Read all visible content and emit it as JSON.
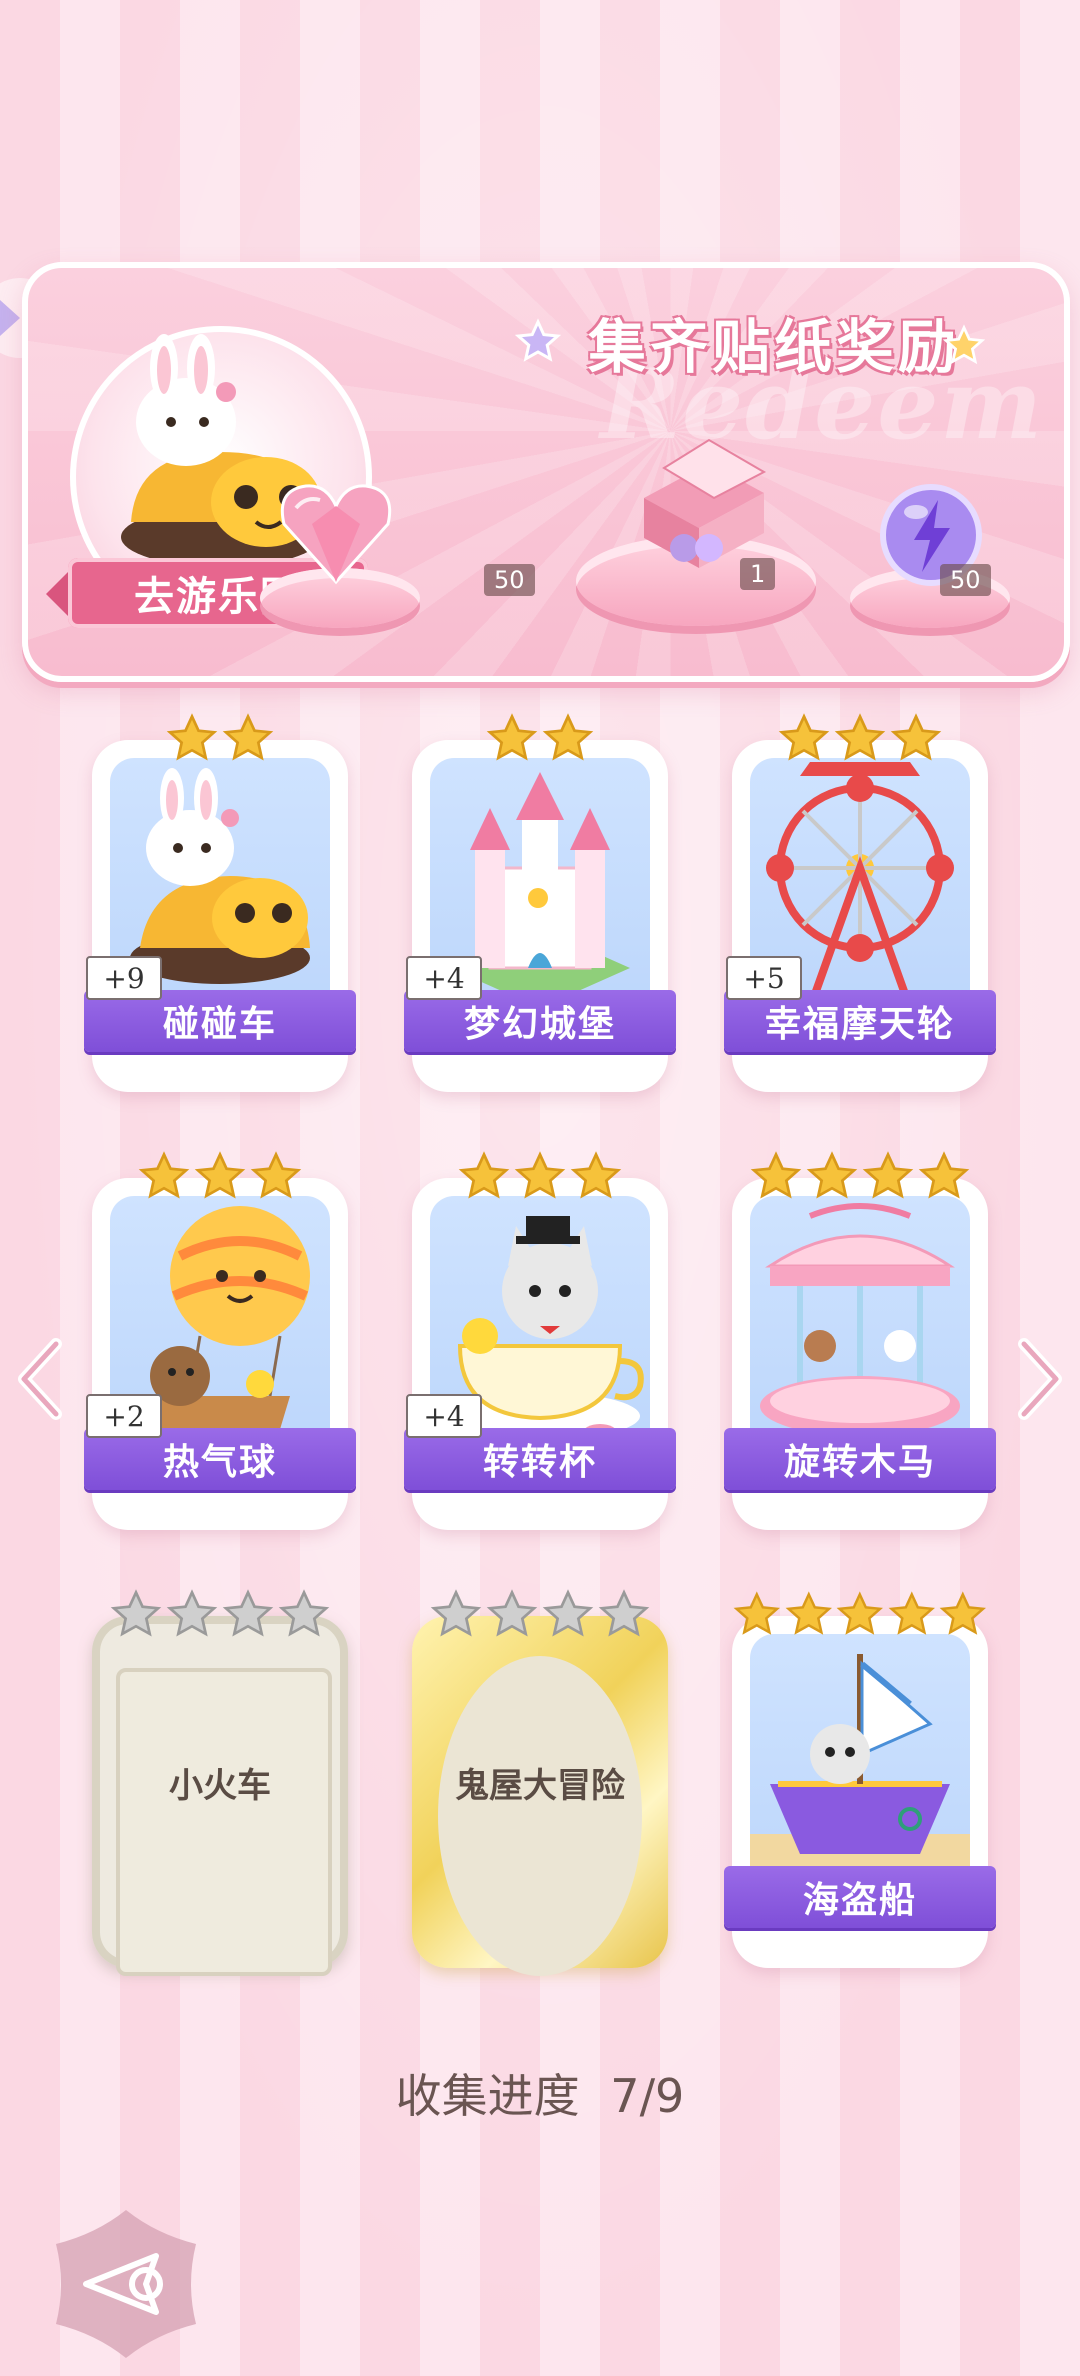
{
  "banner": {
    "title": "集齐贴纸奖励",
    "watermark": "Redeem",
    "park_button_label": "去游乐园",
    "rewards": [
      {
        "icon": "pink-heart-gem-icon",
        "count": "50"
      },
      {
        "icon": "sticker-gift-box-icon",
        "count": "1"
      },
      {
        "icon": "purple-lightning-orb-icon",
        "count": "50"
      }
    ]
  },
  "cards": [
    {
      "name": "碰碰车",
      "plus": "+9",
      "stars_filled": 2,
      "stars_total": 2,
      "state": "collected",
      "art": "bunny-bumper-car"
    },
    {
      "name": "梦幻城堡",
      "plus": "+4",
      "stars_filled": 2,
      "stars_total": 2,
      "state": "collected",
      "art": "dream-castle"
    },
    {
      "name": "幸福摩天轮",
      "plus": "+5",
      "stars_filled": 3,
      "stars_total": 3,
      "state": "collected",
      "art": "ferris-wheel"
    },
    {
      "name": "热气球",
      "plus": "+2",
      "stars_filled": 3,
      "stars_total": 3,
      "state": "collected",
      "art": "hot-air-balloon"
    },
    {
      "name": "转转杯",
      "plus": "+4",
      "stars_filled": 3,
      "stars_total": 3,
      "state": "collected",
      "art": "teacup-cat"
    },
    {
      "name": "旋转木马",
      "plus": "",
      "stars_filled": 4,
      "stars_total": 4,
      "state": "collected",
      "art": "carousel"
    },
    {
      "name": "小火车",
      "plus": "",
      "stars_filled": 0,
      "stars_total": 4,
      "state": "locked-silver",
      "art": ""
    },
    {
      "name": "鬼屋大冒险",
      "plus": "",
      "stars_filled": 0,
      "stars_total": 4,
      "state": "locked-gold",
      "art": ""
    },
    {
      "name": "海盗船",
      "plus": "",
      "stars_filled": 5,
      "stars_total": 5,
      "state": "collected",
      "art": "pirate-ship"
    }
  ],
  "progress": {
    "label": "收集进度",
    "value": "7/9"
  },
  "colors": {
    "accent_pink": "#e7668e",
    "card_label_purple": "#8a5ae0",
    "star_gold": "#f6c23a",
    "star_grey": "#cfcfcf"
  }
}
